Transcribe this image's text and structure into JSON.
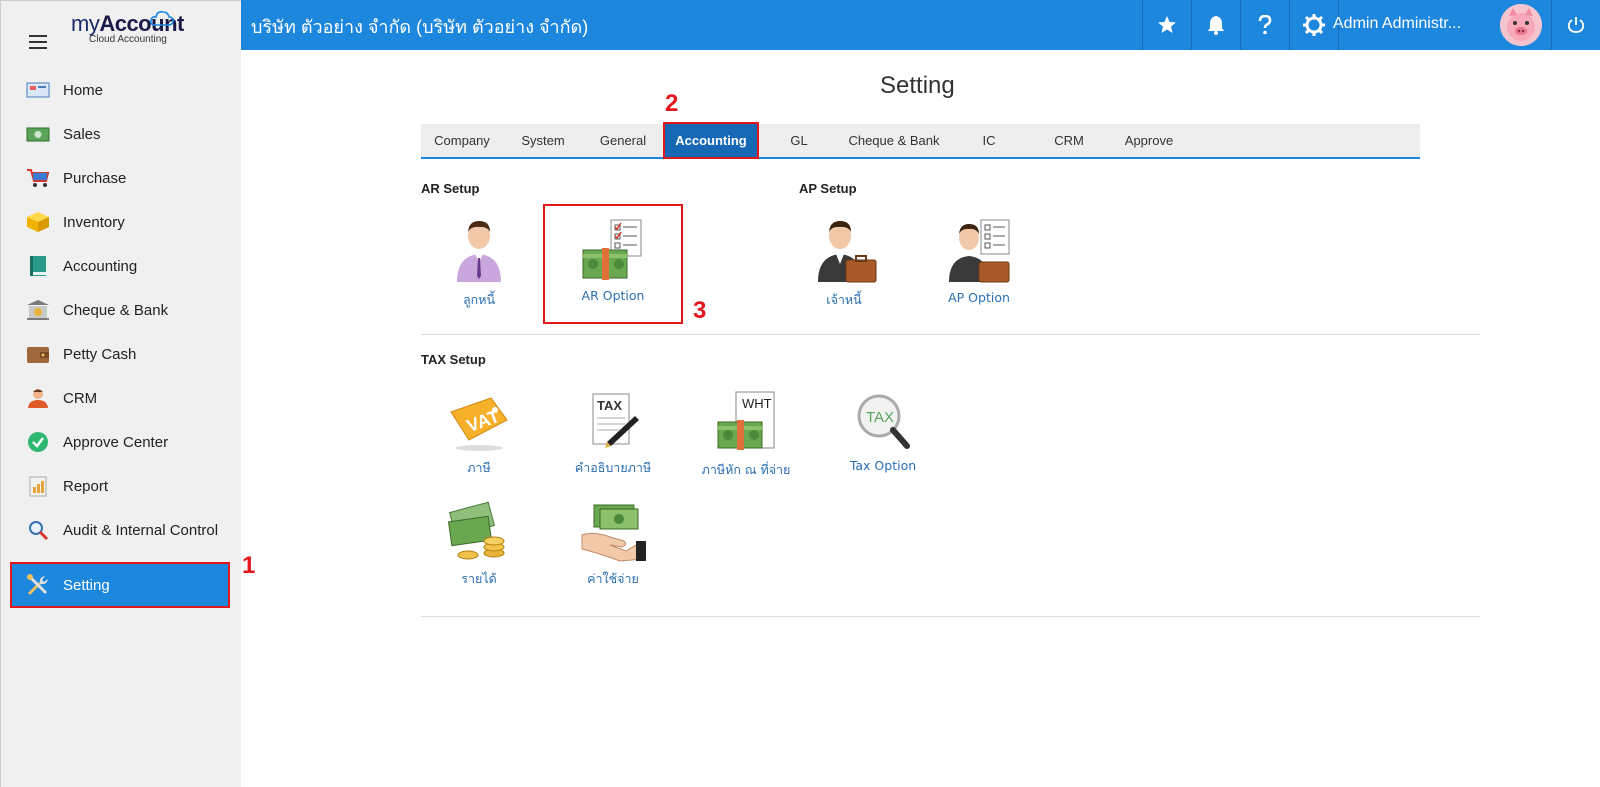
{
  "app": {
    "brand_my": "my",
    "brand_account": "Account",
    "brand_sub": "Cloud Accounting",
    "company_title": "บริษัท ตัวอย่าง จำกัด (บริษัท ตัวอย่าง จำกัด)",
    "user_name": "Admin Administr..."
  },
  "sidebar": {
    "items": [
      {
        "label": "Home",
        "icon": "home-icon"
      },
      {
        "label": "Sales",
        "icon": "sales-icon"
      },
      {
        "label": "Purchase",
        "icon": "cart-icon"
      },
      {
        "label": "Inventory",
        "icon": "box-icon"
      },
      {
        "label": "Accounting",
        "icon": "book-icon"
      },
      {
        "label": "Cheque & Bank",
        "icon": "bank-icon"
      },
      {
        "label": "Petty Cash",
        "icon": "wallet-icon"
      },
      {
        "label": "CRM",
        "icon": "crm-icon"
      },
      {
        "label": "Approve Center",
        "icon": "check-circle-icon"
      },
      {
        "label": "Report",
        "icon": "report-icon"
      },
      {
        "label": "Audit & Internal Control",
        "icon": "audit-icon"
      },
      {
        "label": "Setting",
        "icon": "tools-icon",
        "active": true
      }
    ]
  },
  "page": {
    "title": "Setting",
    "tabs": [
      "Company",
      "System",
      "General",
      "Accounting",
      "GL",
      "Cheque & Bank",
      "IC",
      "CRM",
      "Approve"
    ],
    "active_tab": "Accounting"
  },
  "sections": {
    "ar_setup": "AR Setup",
    "ap_setup": "AP Setup",
    "tax_setup": "TAX Setup"
  },
  "tiles": {
    "debtor": "ลูกหนี้",
    "ar_option": "AR Option",
    "creditor": "เจ้าหนี้",
    "ap_option": "AP Option",
    "tax": "ภาษี",
    "tax_desc": "คำอธิบายภาษี",
    "wht": "ภาษีหัก ณ ที่จ่าย",
    "tax_option": "Tax Option",
    "income": "รายได้",
    "expense": "ค่าใช้จ่าย",
    "vat_text": "VAT",
    "tax_text": "TAX",
    "wht_text": "WHT"
  },
  "annotations": {
    "m1": "1",
    "m2": "2",
    "m3": "3"
  },
  "colors": {
    "primary": "#1d86dd",
    "highlight": "#e3161c",
    "link": "#2a6fb3"
  }
}
